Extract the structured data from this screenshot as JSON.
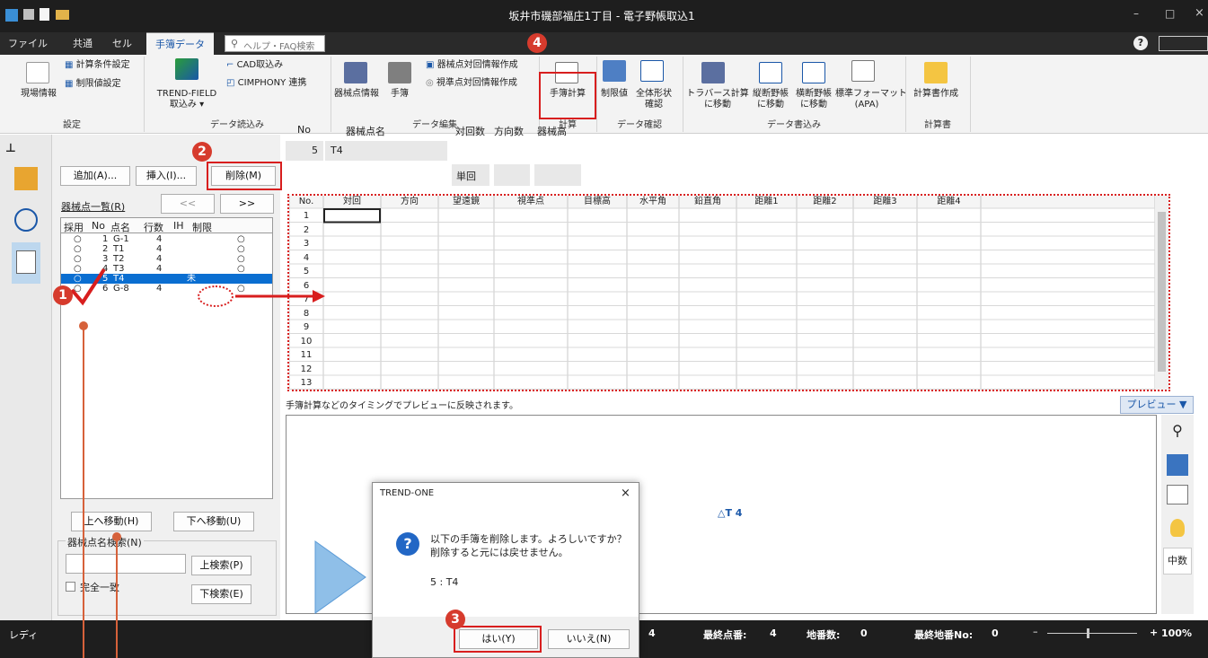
{
  "window": {
    "title": "坂井市磯部福庄1丁目 - 電子野帳取込1",
    "controls": [
      "–",
      "□",
      "×"
    ],
    "help": "?"
  },
  "tabs": [
    "ファイル",
    "共通",
    "セル",
    "手簿データ"
  ],
  "search_placeholder": "ヘルプ・FAQ検索",
  "ribbon": {
    "genba": "現場情報",
    "calc_cond": "計算条件設定",
    "limit_set": "制限値設定",
    "group_settei": "設定",
    "trend_field_1": "TREND-FIELD",
    "trend_field_2": "取込み ▾",
    "cad": "CAD取込み",
    "cimphony": "CIMPHONY 連携",
    "group_read": "データ読込み",
    "kikai_info": "器械点情報",
    "tebo": "手簿",
    "kikai_taikai": "器械点対回情報作成",
    "shijun_taikai": "視準点対回情報作成",
    "group_edit": "データ編集",
    "tebo_keisan": "手簿計算",
    "group_calc": "計算",
    "seigenchi": "制限値",
    "zentai_1": "全体形状",
    "zentai_2": "確認",
    "group_check": "データ確認",
    "trav_1": "トラバース計算",
    "trav_2": "に移動",
    "ju_1": "縦断野帳",
    "ju_2": "に移動",
    "ou_1": "横断野帳",
    "ou_2": "に移動",
    "std_1": "標準フォーマット",
    "std_2": "(APA)",
    "group_write": "データ書込み",
    "keisansho": "計算書作成",
    "group_sheet": "計算書"
  },
  "panel": {
    "add": "追加(A)...",
    "insert": "挿入(I)...",
    "delete": "削除(M)",
    "list_label": "器械点一覧(R)",
    "prev": "<<",
    "next": ">>",
    "cols": [
      "採用",
      "No",
      "点名",
      "行数",
      "IH",
      "制限"
    ],
    "rows": [
      {
        "use": "○",
        "no": "1",
        "name": "G-1",
        "rows": "4",
        "ih": "",
        "lim": "○"
      },
      {
        "use": "○",
        "no": "2",
        "name": "T1",
        "rows": "4",
        "ih": "",
        "lim": "○"
      },
      {
        "use": "○",
        "no": "3",
        "name": "T2",
        "rows": "4",
        "ih": "",
        "lim": "○"
      },
      {
        "use": "○",
        "no": "4",
        "name": "T3",
        "rows": "4",
        "ih": "",
        "lim": "○"
      },
      {
        "use": "○",
        "no": "5",
        "name": "T4",
        "rows": "",
        "ih": "未",
        "lim": ""
      },
      {
        "use": "○",
        "no": "6",
        "name": "G-8",
        "rows": "4",
        "ih": "",
        "lim": "○"
      }
    ],
    "up": "上へ移動(H)",
    "down": "下へ移動(U)",
    "search_label": "器械点名検索(N)",
    "search_up": "上検索(P)",
    "search_down": "下検索(E)",
    "exact": "完全一致"
  },
  "header": {
    "no_label": "No",
    "name_label": "器械点名",
    "taikai_label": "対回数",
    "houkou_label": "方向数",
    "kikaikou_label": "器械高",
    "no_val": "5",
    "name_val": "T4",
    "taikai_val": "単回"
  },
  "grid": {
    "cols": [
      "No.",
      "対回",
      "方向",
      "望遠鏡",
      "視準点",
      "目標高",
      "水平角",
      "鉛直角",
      "距離1",
      "距離2",
      "距離3",
      "距離4"
    ],
    "rows": [
      "1",
      "2",
      "3",
      "4",
      "5",
      "6",
      "7",
      "8",
      "9",
      "10",
      "11",
      "12",
      "13"
    ]
  },
  "preview": {
    "hint": "手簿計算などのタイミングでプレビューに反映されます。",
    "btn": "プレビュー",
    "point": "△T 4",
    "side_text": "中数"
  },
  "dialog": {
    "title": "TREND-ONE",
    "msg1": "以下の手簿を削除します。よろしいですか？",
    "msg2": "削除すると元には戻せません。",
    "item": "5 : T4",
    "yes": "はい(Y)",
    "no": "いいえ(N)",
    "close": "×"
  },
  "status": {
    "ready": "レディ",
    "count": "4",
    "last_label": "最終点番:",
    "last_val": "4",
    "chi_label": "地番数:",
    "chi_val": "0",
    "lastchi_label": "最終地番No:",
    "lastchi_val": "0",
    "zoom": "100%",
    "minus": "–",
    "plus": "+"
  },
  "markers": [
    "1",
    "2",
    "3",
    "4"
  ],
  "colors": {
    "accent": "#1a57a8",
    "marker": "#d63b2d",
    "select": "#0a6ed1"
  }
}
